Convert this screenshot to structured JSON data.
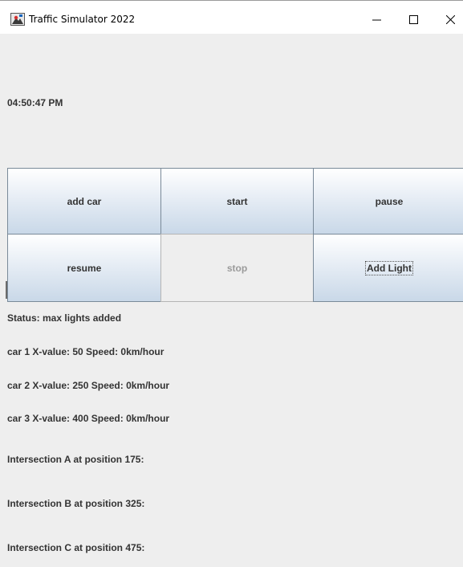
{
  "window": {
    "title": "Traffic Simulator 2022",
    "icon": "java-app-icon",
    "controls": [
      "minimize-icon",
      "maximize-icon",
      "close-icon"
    ]
  },
  "clock": {
    "time": "04:50:47 PM"
  },
  "buttons": {
    "add_car": "add car",
    "start": "start",
    "pause": "pause",
    "resume": "resume",
    "stop": "stop",
    "add_light": "Add Light"
  },
  "status": {
    "text": "Status: max lights added"
  },
  "cars": [
    "car 1 X-value: 50 Speed: 0km/hour",
    "car 2 X-value: 250 Speed: 0km/hour",
    "car 3 X-value: 400 Speed: 0km/hour"
  ],
  "intersections": [
    "Intersection A at position 175:",
    "Intersection B at position 325:",
    "Intersection C at position 475:"
  ],
  "colors": {
    "titlebar": "#ffffff",
    "panel": "#eeeeee",
    "button_top": "#ffffff",
    "button_bottom": "#c9d8e8",
    "button_border": "#7a8a99",
    "text": "#333333",
    "disabled_text": "#9a9a9a"
  }
}
